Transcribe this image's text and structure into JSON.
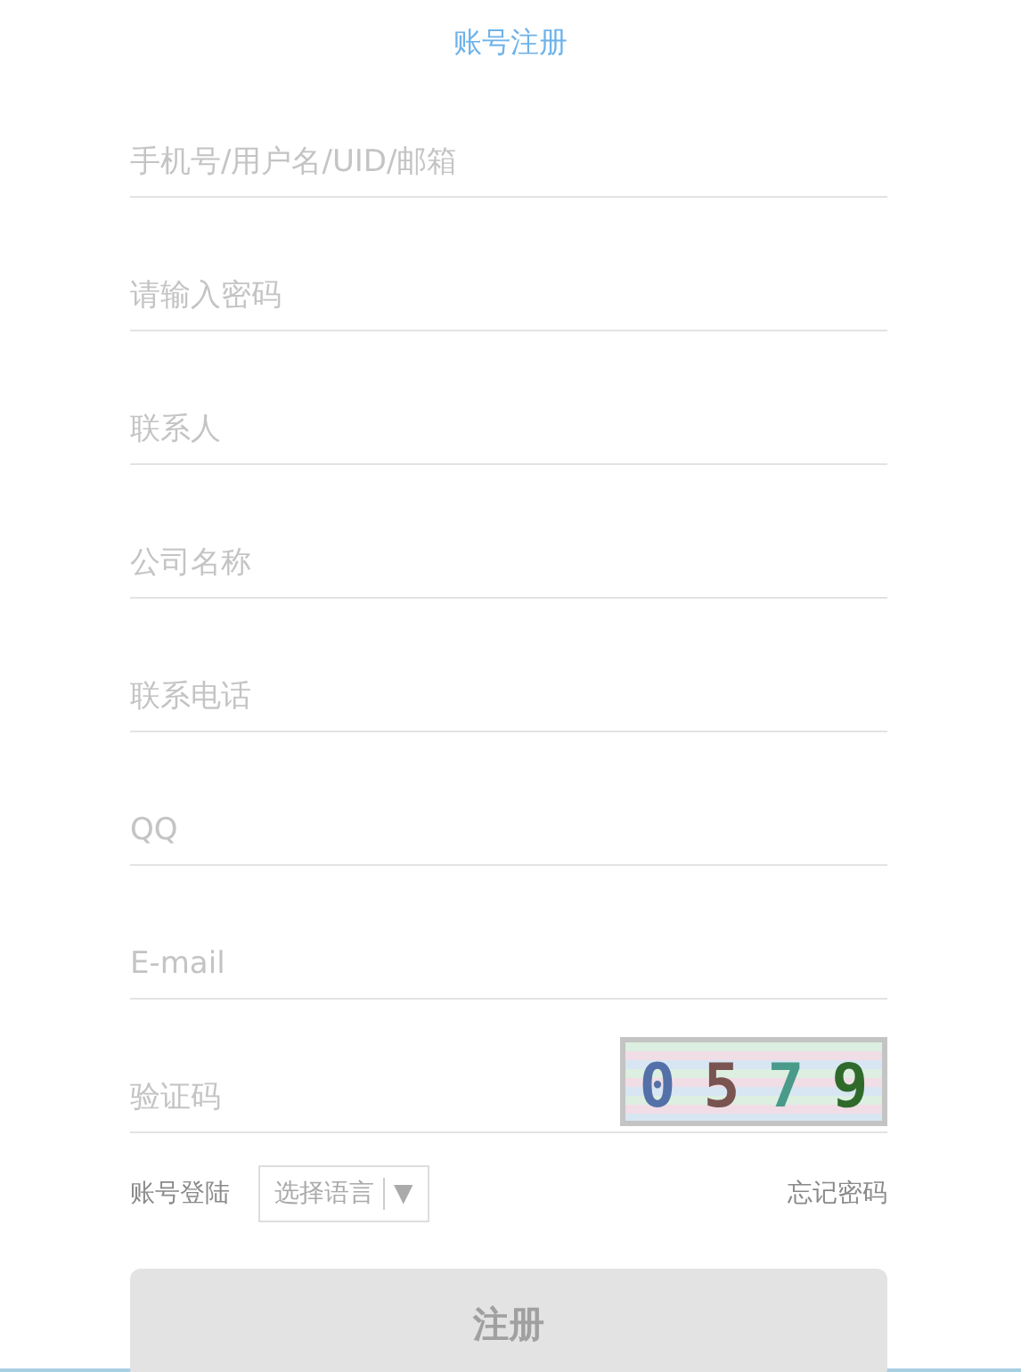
{
  "title": "账号注册",
  "fields": [
    {
      "placeholder": "手机号/用户名/UID/邮箱",
      "kind": "text"
    },
    {
      "placeholder": "请输入密码",
      "kind": "password"
    },
    {
      "placeholder": "联系人",
      "kind": "text"
    },
    {
      "placeholder": "公司名称",
      "kind": "text"
    },
    {
      "placeholder": "联系电话",
      "kind": "text"
    },
    {
      "placeholder": "QQ",
      "kind": "text"
    },
    {
      "placeholder": "E-mail",
      "kind": "text"
    },
    {
      "placeholder": "验证码",
      "kind": "captcha",
      "captcha": [
        {
          "text": "0",
          "color": "#5470a8"
        },
        {
          "text": "5",
          "color": "#7a5450"
        },
        {
          "text": "7",
          "color": "#4a9a8a"
        },
        {
          "text": "9",
          "color": "#2f6a2a"
        }
      ]
    }
  ],
  "login_link": "账号登陆",
  "language_select": {
    "value": "选择语言",
    "arrow": "▼"
  },
  "forgot_link": "忘记密码",
  "submit": "注册"
}
